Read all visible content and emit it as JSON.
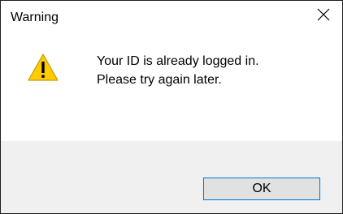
{
  "window": {
    "title": "Warning",
    "close_icon": "close-icon"
  },
  "message": {
    "icon": "warning-icon",
    "line1": "Your ID is already logged in.",
    "line2": "Please try again later."
  },
  "buttons": {
    "ok_label": "OK"
  },
  "colors": {
    "warning_yellow": "#FFCC00",
    "button_border": "#0078D7",
    "button_fill": "#E1E1E1",
    "footer_bg": "#F0F0F0"
  }
}
